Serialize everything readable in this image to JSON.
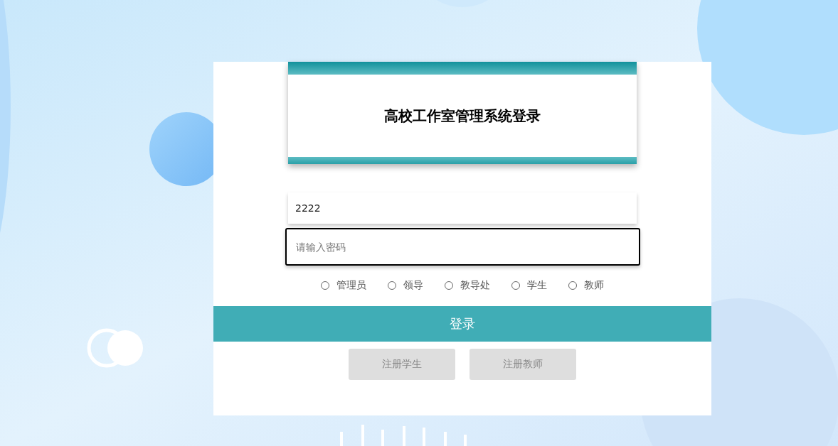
{
  "title": "高校工作室管理系统登录",
  "username": {
    "value": "2222",
    "focused": false
  },
  "password": {
    "placeholder": "请输入密码",
    "focused": true
  },
  "roles": [
    {
      "label": "管理员",
      "selected": false
    },
    {
      "label": "领导",
      "selected": false
    },
    {
      "label": "教导处",
      "selected": false
    },
    {
      "label": "学生",
      "selected": false
    },
    {
      "label": "教师",
      "selected": false
    }
  ],
  "login_button": "登录",
  "register_buttons": [
    "注册学生",
    "注册教师"
  ]
}
